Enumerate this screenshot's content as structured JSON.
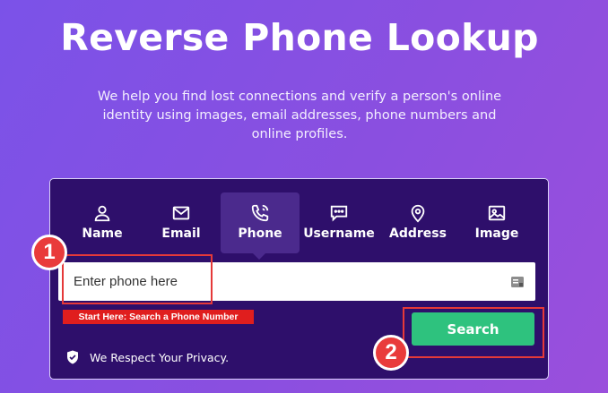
{
  "hero": {
    "title": "Reverse Phone Lookup",
    "subtitle": "We help you find lost connections and verify a person's online identity using images, email addresses, phone numbers and online profiles."
  },
  "tabs": [
    {
      "label": "Name",
      "icon": "person-icon"
    },
    {
      "label": "Email",
      "icon": "envelope-icon"
    },
    {
      "label": "Phone",
      "icon": "phone-icon",
      "active": true
    },
    {
      "label": "Username",
      "icon": "chat-bubble-icon"
    },
    {
      "label": "Address",
      "icon": "location-pin-icon"
    },
    {
      "label": "Image",
      "icon": "image-icon"
    }
  ],
  "search": {
    "placeholder": "Enter phone here",
    "value": "",
    "button_label": "Search",
    "hint": "Start Here: Search a Phone Number"
  },
  "badges": {
    "step1": "1",
    "step2": "2"
  },
  "privacy": {
    "text": "We Respect Your Privacy."
  },
  "colors": {
    "background": "#8a4fe0",
    "panel": "#2e0f6b",
    "active_tab": "#4b2a8d",
    "search_button": "#2ec27e",
    "highlight": "#e53939"
  }
}
